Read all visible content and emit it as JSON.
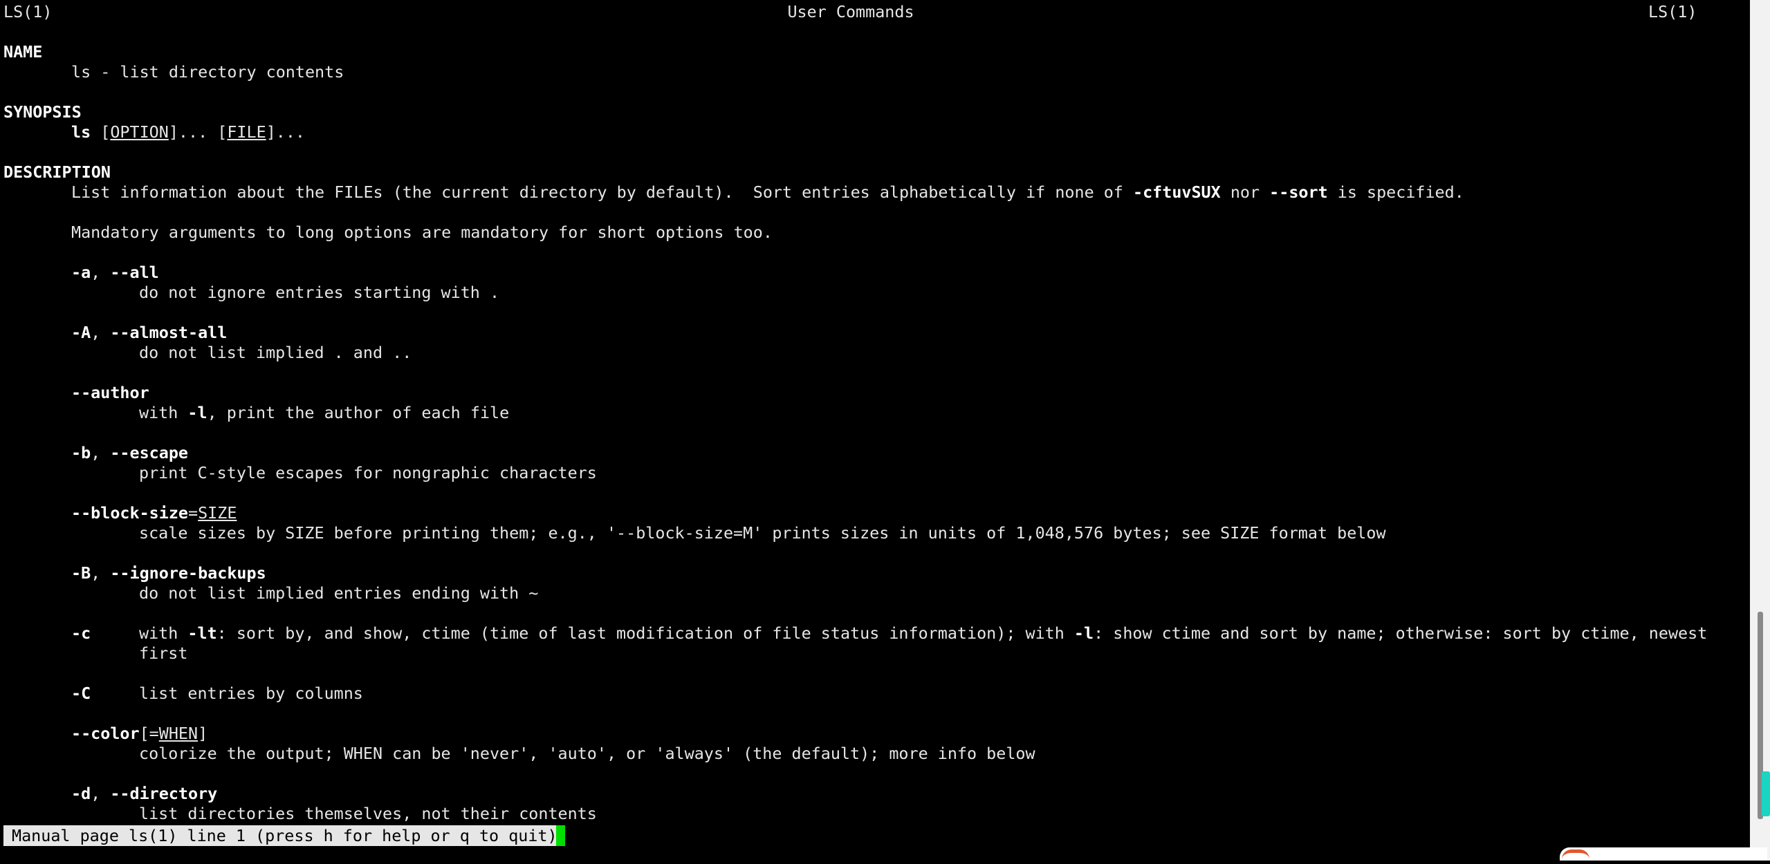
{
  "header": {
    "left": "LS(1)",
    "center": "User Commands",
    "right": "LS(1)"
  },
  "sections": {
    "name": {
      "heading": "NAME",
      "text": "ls - list directory contents"
    },
    "synopsis": {
      "heading": "SYNOPSIS",
      "cmd": "ls",
      "p1": " [",
      "option": "OPTION",
      "p2": "]... [",
      "file": "FILE",
      "p3": "]..."
    },
    "description": {
      "heading": "DESCRIPTION",
      "l1a": "List information about the FILEs (the current directory by default).  Sort entries alphabetically if none of ",
      "l1b": "-cftuvSUX",
      "l1c": " nor ",
      "l1d": "--sort",
      "l1e": " is specified.",
      "l2": "Mandatory arguments to long options are mandatory for short options too."
    }
  },
  "options": {
    "a": {
      "flag1": "-a",
      "sep": ", ",
      "flag2": "--all",
      "desc": "do not ignore entries starting with ."
    },
    "A": {
      "flag1": "-A",
      "sep": ", ",
      "flag2": "--almost-all",
      "desc": "do not list implied . and .."
    },
    "author": {
      "flag": "--author",
      "d1": "with ",
      "d2": "-l",
      "d3": ", print the author of each file"
    },
    "b": {
      "flag1": "-b",
      "sep": ", ",
      "flag2": "--escape",
      "desc": "print C-style escapes for nongraphic characters"
    },
    "block_size": {
      "flag": "--block-size",
      "eq": "=",
      "arg": "SIZE",
      "desc": "scale sizes by SIZE before printing them; e.g., '--block-size=M' prints sizes in units of 1,048,576 bytes; see SIZE format below"
    },
    "B": {
      "flag1": "-B",
      "sep": ", ",
      "flag2": "--ignore-backups",
      "desc": "do not list implied entries ending with ~"
    },
    "c": {
      "flag": "-c",
      "d1": "with ",
      "d2": "-lt",
      "d3": ": sort by, and show, ctime (time of last modification of file status information); with ",
      "d4": "-l",
      "d5": ": show ctime and sort by name; otherwise: sort by ctime, newest",
      "d6": "first"
    },
    "C": {
      "flag": "-C",
      "desc": "list entries by columns"
    },
    "color": {
      "flag": "--color",
      "p1": "[=",
      "arg": "WHEN",
      "p2": "]",
      "desc": "colorize the output; WHEN can be 'never', 'auto', or 'always' (the default); more info below"
    },
    "d": {
      "flag1": "-d",
      "sep": ", ",
      "flag2": "--directory",
      "desc": "list directories themselves, not their contents"
    }
  },
  "status": {
    "prompt": "Manual page ls(1) line 1 (press h for help or q to quit)"
  },
  "colors": {
    "background": "#000000",
    "text": "#e6e6e6",
    "cursor": "#00e000",
    "status_bg": "#e6e6e6",
    "scroll_accent": "#18d6c2"
  }
}
